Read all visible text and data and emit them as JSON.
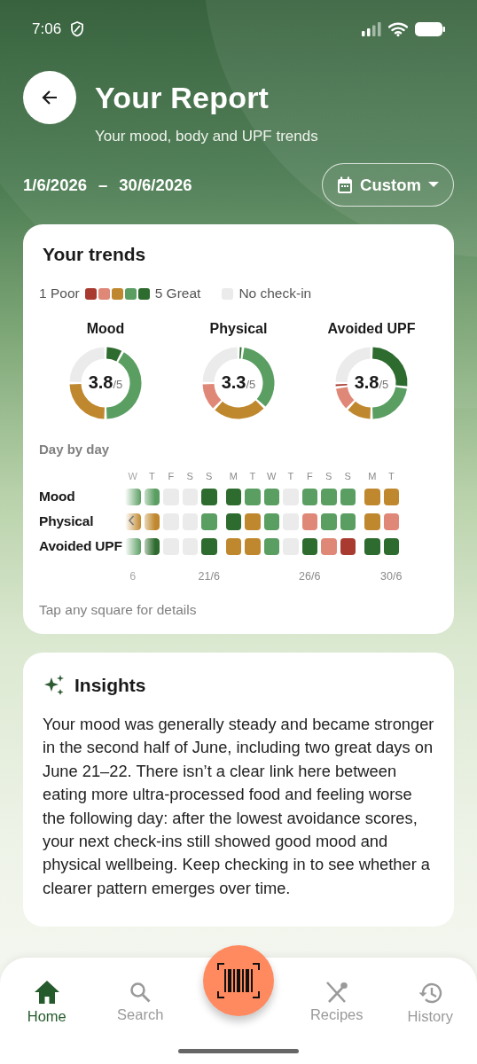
{
  "status_bar": {
    "time": "7:06"
  },
  "header": {
    "title": "Your Report",
    "subtitle": "Your mood, body and UPF trends",
    "date_start": "1/6/2026",
    "date_separator": "–",
    "date_end": "30/6/2026",
    "range_button": "Custom"
  },
  "trends": {
    "title": "Your trends",
    "legend": {
      "low_label": "1 Poor",
      "high_label": "5 Great",
      "none_label": "No check-in",
      "swatches": [
        {
          "color": "#a83a2f"
        },
        {
          "color": "#e08878"
        },
        {
          "color": "#c0882e"
        },
        {
          "color": "#5a9e62"
        },
        {
          "color": "#2e6b2e"
        }
      ]
    },
    "summaries": [
      {
        "label": "Mood",
        "score": "3.8",
        "scale": "/5"
      },
      {
        "label": "Physical",
        "score": "3.3",
        "scale": "/5"
      },
      {
        "label": "Avoided UPF",
        "score": "3.8",
        "scale": "/5"
      }
    ],
    "heatmap": {
      "title": "Day by day",
      "weeks": [
        {
          "days": [
            {
              "label": "W",
              "date": "6"
            },
            {
              "label": "T"
            },
            {
              "label": "F"
            },
            {
              "label": "S"
            },
            {
              "label": "S",
              "date": "21/6"
            }
          ]
        },
        {
          "days": [
            {
              "label": "M"
            },
            {
              "label": "T"
            },
            {
              "label": "W"
            },
            {
              "label": "T"
            },
            {
              "label": "F",
              "date": "26/6"
            },
            {
              "label": "S"
            },
            {
              "label": "S"
            }
          ]
        },
        {
          "days": [
            {
              "label": "M"
            },
            {
              "label": "T",
              "date": "30/6"
            }
          ]
        }
      ],
      "rows": [
        {
          "label": "Mood",
          "weeks": [
            [
              {
                "color": "#5a9e62"
              },
              {
                "color": "#5a9e62"
              },
              {
                "color": "#ebebeb"
              },
              {
                "color": "#ebebeb"
              },
              {
                "color": "#2e6b2e"
              }
            ],
            [
              {
                "color": "#2e6b2e"
              },
              {
                "color": "#5a9e62"
              },
              {
                "color": "#5a9e62"
              },
              {
                "color": "#ebebeb"
              },
              {
                "color": "#5a9e62"
              },
              {
                "color": "#5a9e62"
              },
              {
                "color": "#5a9e62"
              }
            ],
            [
              {
                "color": "#c0882e"
              },
              {
                "color": "#c0882e"
              }
            ]
          ]
        },
        {
          "label": "Physical",
          "weeks": [
            [
              {
                "color": "#c0882e"
              },
              {
                "color": "#c0882e"
              },
              {
                "color": "#ebebeb"
              },
              {
                "color": "#ebebeb"
              },
              {
                "color": "#5a9e62"
              }
            ],
            [
              {
                "color": "#2e6b2e"
              },
              {
                "color": "#c0882e"
              },
              {
                "color": "#5a9e62"
              },
              {
                "color": "#ebebeb"
              },
              {
                "color": "#e08878"
              },
              {
                "color": "#5a9e62"
              },
              {
                "color": "#5a9e62"
              }
            ],
            [
              {
                "color": "#c0882e"
              },
              {
                "color": "#e08878"
              }
            ]
          ]
        },
        {
          "label": "Avoided UPF",
          "weeks": [
            [
              {
                "color": "#5a9e62"
              },
              {
                "color": "#2e6b2e"
              },
              {
                "color": "#ebebeb"
              },
              {
                "color": "#ebebeb"
              },
              {
                "color": "#2e6b2e"
              }
            ],
            [
              {
                "color": "#c0882e"
              },
              {
                "color": "#c0882e"
              },
              {
                "color": "#5a9e62"
              },
              {
                "color": "#ebebeb"
              },
              {
                "color": "#2e6b2e"
              },
              {
                "color": "#e08878"
              },
              {
                "color": "#a83a2f"
              }
            ],
            [
              {
                "color": "#2e6b2e"
              },
              {
                "color": "#2e6b2e"
              }
            ]
          ]
        }
      ],
      "hint": "Tap any square for details"
    }
  },
  "insights": {
    "title": "Insights",
    "text": "Your mood was generally steady and became stronger in the second half of June, including two great days on June 21–22. There isn’t a clear link here between eating more ultra-processed food and feeling worse the following day: after the lowest avoidance scores, your next check-ins still showed good mood and physical wellbeing. Keep checking in to see whether a clearer pattern emerges over time."
  },
  "bottom_nav": {
    "items": [
      {
        "label": "Home",
        "selected": true
      },
      {
        "label": "Search",
        "selected": false
      },
      {
        "label": "Recipes",
        "selected": false
      },
      {
        "label": "History",
        "selected": false
      }
    ]
  }
}
